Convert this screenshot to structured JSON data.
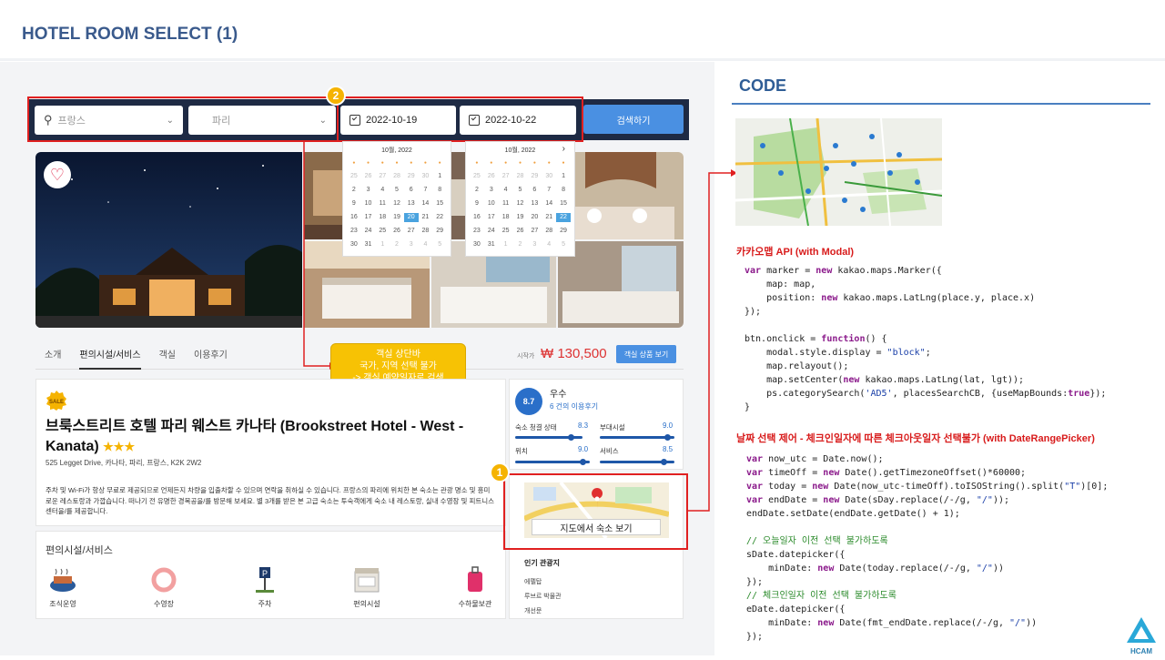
{
  "page_title": "HOTEL ROOM SELECT (1)",
  "search": {
    "country": "프랑스",
    "city": "파리",
    "checkin": "2022-10-19",
    "checkout": "2022-10-22",
    "search_button": "검색하기"
  },
  "badges": {
    "one": "1",
    "two": "2"
  },
  "calendar": {
    "month_label": "10월, 2022",
    "next_arrow": "›",
    "weekday_marks": [
      "●",
      "●",
      "●",
      "●",
      "●",
      "●",
      "●"
    ],
    "left": {
      "rows": [
        [
          "25",
          "26",
          "27",
          "28",
          "29",
          "30",
          "1"
        ],
        [
          "2",
          "3",
          "4",
          "5",
          "6",
          "7",
          "8"
        ],
        [
          "9",
          "10",
          "11",
          "12",
          "13",
          "14",
          "15"
        ],
        [
          "16",
          "17",
          "18",
          "19",
          "20",
          "21",
          "22"
        ],
        [
          "23",
          "24",
          "25",
          "26",
          "27",
          "28",
          "29"
        ],
        [
          "30",
          "31",
          "1",
          "2",
          "3",
          "4",
          "5"
        ]
      ],
      "selected": "20"
    },
    "right": {
      "rows": [
        [
          "25",
          "26",
          "27",
          "28",
          "29",
          "30",
          "1"
        ],
        [
          "2",
          "3",
          "4",
          "5",
          "6",
          "7",
          "8"
        ],
        [
          "9",
          "10",
          "11",
          "12",
          "13",
          "14",
          "15"
        ],
        [
          "16",
          "17",
          "18",
          "19",
          "20",
          "21",
          "22"
        ],
        [
          "23",
          "24",
          "25",
          "26",
          "27",
          "28",
          "29"
        ],
        [
          "30",
          "31",
          "1",
          "2",
          "3",
          "4",
          "5"
        ]
      ],
      "selected": "22"
    }
  },
  "tabs": [
    "소개",
    "편의시설/서비스",
    "객실",
    "이용후기"
  ],
  "price": {
    "label": "시작가",
    "value": "₩ 130,500",
    "button": "객실 상품 보기"
  },
  "note": {
    "line1": "객실 상단바",
    "line2": "국가, 지역 선택 불가",
    "line3": "-> 객실 예약일자로 검색"
  },
  "hotel": {
    "sale_badge": "SALE",
    "name": "브룩스트리트 호텔 파리 웨스트 카나타 (Brookstreet Hotel - West - Kanata)",
    "stars": "★★★",
    "address": "525 Legget Drive, 카나타, 파리, 프랑스, K2K 2W2",
    "description": "주차 및 Wi-Fi가 항상 무료로 제공되므로 언제든지 차량을 입출차할 수 있으며 연락을 취하실 수 있습니다. 프랑스의 파리에 위치한 본 숙소는 관광 명소 및 흥미로운 레스토랑과 가깝습니다. 떠나기 전 유명한 경목공을/를 방문해 보세요. 별 3개를 받은 본 고급 숙소는 투숙객에게 숙소 내 레스토랑, 실내 수영장 및 피트니스 센터을/를 제공합니다."
  },
  "amenities": {
    "title": "편의시설/서비스",
    "items": [
      {
        "label": "조식운영",
        "icon": "breakfast-icon"
      },
      {
        "label": "수영장",
        "icon": "pool-icon"
      },
      {
        "label": "주차",
        "icon": "parking-icon"
      },
      {
        "label": "편의시설",
        "icon": "store-icon"
      },
      {
        "label": "수하물보관",
        "icon": "luggage-icon"
      }
    ]
  },
  "rating": {
    "score": "8.7",
    "grade": "우수",
    "reviews": "6 건의 이용후기",
    "items": [
      {
        "label": "숙소 청결 상태",
        "value": "8.3",
        "fraction": 0.83
      },
      {
        "label": "부대시설",
        "value": "9.0",
        "fraction": 0.9
      },
      {
        "label": "위치",
        "value": "9.0",
        "fraction": 0.9
      },
      {
        "label": "서비스",
        "value": "8.5",
        "fraction": 0.85
      }
    ]
  },
  "map": {
    "button": "지도에서 숙소 보기"
  },
  "attractions": {
    "title": "인기 관광지",
    "items": [
      "에펠탑",
      "루브르 박물관",
      "개선문"
    ]
  },
  "code_panel": {
    "title": "CODE",
    "section1": "카카오맵 API (with Modal)",
    "section2": "날짜 선택 제어 - 체크인일자에 따른 체크아웃일자 선택불가 (with DateRangePicker)"
  },
  "logo_text": "HCAM",
  "colors": {
    "accent": "#4a90e2",
    "navy": "#1e2a44",
    "highlight": "#e02020",
    "badge": "#f5b301"
  }
}
